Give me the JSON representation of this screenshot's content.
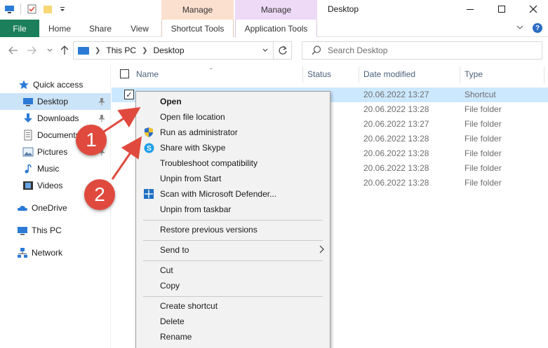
{
  "window": {
    "title": "Desktop"
  },
  "context_tabs": {
    "shortcut_manage": "Manage",
    "app_manage": "Manage"
  },
  "ribbon": {
    "tabs": [
      "File",
      "Home",
      "Share",
      "View",
      "Shortcut Tools",
      "Application Tools"
    ]
  },
  "address": {
    "crumbs": [
      "This PC",
      "Desktop"
    ],
    "search_placeholder": "Search Desktop"
  },
  "nav": {
    "items": [
      {
        "label": "Quick access",
        "icon": "star-icon"
      },
      {
        "label": "Desktop",
        "icon": "desktop-icon",
        "selected": true,
        "pinned": true
      },
      {
        "label": "Downloads",
        "icon": "download-icon",
        "pinned": true
      },
      {
        "label": "Documents",
        "icon": "documents-icon",
        "pinned": true
      },
      {
        "label": "Pictures",
        "icon": "pictures-icon",
        "pinned": true
      },
      {
        "label": "Music",
        "icon": "music-icon"
      },
      {
        "label": "Videos",
        "icon": "videos-icon"
      },
      {
        "label": "OneDrive",
        "icon": "cloud-icon"
      },
      {
        "label": "This PC",
        "icon": "pc-icon"
      },
      {
        "label": "Network",
        "icon": "network-icon"
      }
    ]
  },
  "columns": {
    "name": "Name",
    "status": "Status",
    "date": "Date modified",
    "type": "Type"
  },
  "rows": [
    {
      "date": "20.06.2022 13:27",
      "type": "Shortcut",
      "selected": true
    },
    {
      "date": "20.06.2022 13:28",
      "type": "File folder"
    },
    {
      "date": "20.06.2022 13:27",
      "type": "File folder"
    },
    {
      "date": "20.06.2022 13:28",
      "type": "File folder"
    },
    {
      "date": "20.06.2022 13:28",
      "type": "File folder"
    },
    {
      "date": "20.06.2022 13:28",
      "type": "File folder"
    },
    {
      "date": "20.06.2022 13:28",
      "type": "File folder"
    }
  ],
  "context_menu": {
    "open": "Open",
    "open_location": "Open file location",
    "run_admin": "Run as administrator",
    "share_skype": "Share with Skype",
    "troubleshoot": "Troubleshoot compatibility",
    "unpin_start": "Unpin from Start",
    "scan_defender": "Scan with Microsoft Defender...",
    "unpin_taskbar": "Unpin from taskbar",
    "restore": "Restore previous versions",
    "send_to": "Send to",
    "cut": "Cut",
    "copy": "Copy",
    "create_shortcut": "Create shortcut",
    "delete": "Delete",
    "rename": "Rename"
  },
  "annotations": {
    "step1": "1",
    "step2": "2"
  },
  "colors": {
    "file_tab": "#1a7f5a",
    "shortcut_tools": "#fce0cf",
    "application_tools": "#eed9f6",
    "selection": "#cce8ff",
    "badge": "#e04a3e"
  }
}
